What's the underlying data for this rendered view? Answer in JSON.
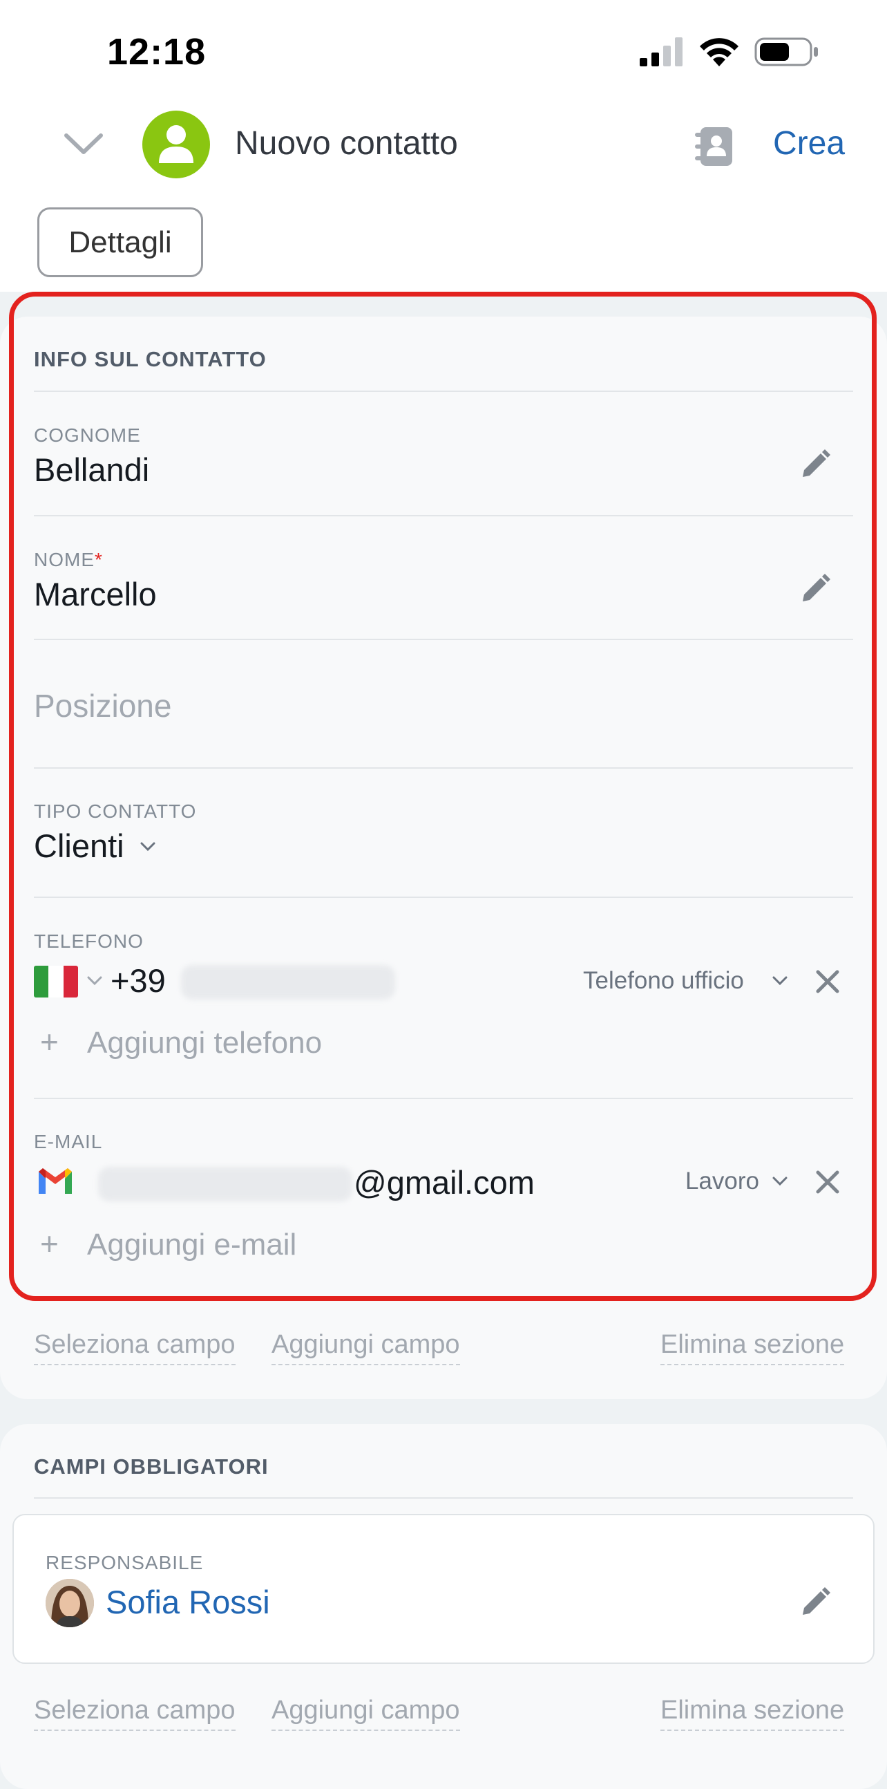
{
  "status_bar": {
    "time": "12:18"
  },
  "header": {
    "title": "Nuovo contatto",
    "create_label": "Crea"
  },
  "tabs": {
    "details": "Dettagli"
  },
  "contact_section": {
    "title": "INFO SUL CONTATTO",
    "cognome": {
      "label": "COGNOME",
      "value": "Bellandi"
    },
    "nome": {
      "label": "NOME",
      "required_mark": "*",
      "value": "Marcello"
    },
    "posizione": {
      "placeholder": "Posizione"
    },
    "tipo": {
      "label": "TIPO CONTATTO",
      "value": "Clienti"
    },
    "telefono": {
      "label": "TELEFONO",
      "prefix": "+39",
      "type": "Telefono ufficio",
      "add_label": "Aggiungi telefono"
    },
    "email": {
      "label": "E-MAIL",
      "domain": "@gmail.com",
      "type": "Lavoro",
      "add_label": "Aggiungi e-mail"
    },
    "actions": {
      "select": "Seleziona campo",
      "add": "Aggiungi campo",
      "delete": "Elimina sezione"
    }
  },
  "required_section": {
    "title": "CAMPI OBBLIGATORI",
    "responsabile": {
      "label": "RESPONSABILE",
      "name": "Sofia Rossi"
    },
    "actions": {
      "select": "Seleziona campo",
      "add": "Aggiungi campo",
      "delete": "Elimina sezione"
    }
  },
  "colors": {
    "accent": "#2166b3",
    "highlight": "#e3221e",
    "avatar_green": "#8ac611"
  }
}
